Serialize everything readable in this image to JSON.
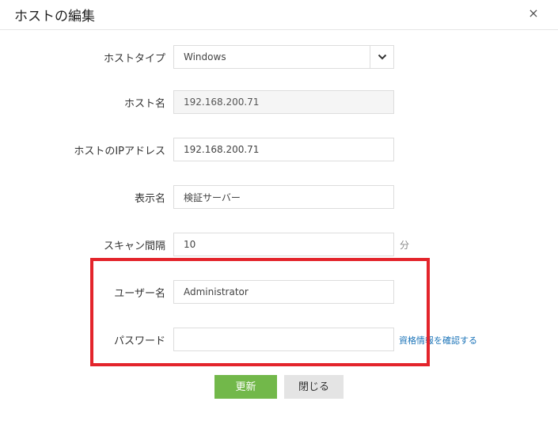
{
  "dialog": {
    "title": "ホストの編集",
    "close_symbol": "×"
  },
  "form": {
    "host_type": {
      "label": "ホストタイプ",
      "selected": "Windows"
    },
    "host_name": {
      "label": "ホスト名",
      "value": "192.168.200.71"
    },
    "host_ip": {
      "label": "ホストのIPアドレス",
      "value": "192.168.200.71"
    },
    "display_name": {
      "label": "表示名",
      "value": "検証サーバー"
    },
    "scan_interval": {
      "label": "スキャン間隔",
      "value": "10",
      "unit": "分"
    },
    "username": {
      "label": "ユーザー名",
      "value": "Administrator"
    },
    "password": {
      "label": "パスワード",
      "value": "",
      "verify_link": "資格情報を確認する"
    }
  },
  "actions": {
    "update_label": "更新",
    "close_label": "閉じる"
  },
  "colors": {
    "primary_button": "#72b84a",
    "highlight_border": "#e3242b",
    "link": "#1a73b8"
  },
  "icons": {
    "close": "close-icon",
    "dropdown": "chevron-down-icon"
  }
}
